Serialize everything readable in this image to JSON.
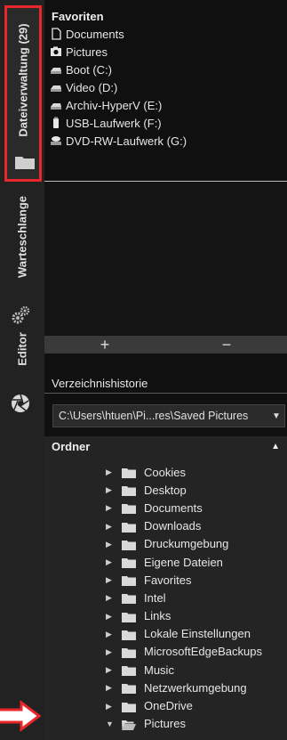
{
  "tabs": {
    "file_manager": "Dateiverwaltung (29)",
    "queue": "Warteschlange",
    "editor": "Editor"
  },
  "favorites": {
    "title": "Favoriten",
    "items": [
      {
        "label": "Documents",
        "icon": "document-icon"
      },
      {
        "label": "Pictures",
        "icon": "camera-icon"
      },
      {
        "label": "Boot (C:)",
        "icon": "drive-icon"
      },
      {
        "label": "Video (D:)",
        "icon": "drive-icon"
      },
      {
        "label": "Archiv-HyperV (E:)",
        "icon": "drive-icon"
      },
      {
        "label": "USB-Laufwerk (F:)",
        "icon": "usb-drive-icon"
      },
      {
        "label": "DVD-RW-Laufwerk (G:)",
        "icon": "dvd-drive-icon"
      }
    ],
    "add_label": "+",
    "remove_label": "−"
  },
  "history": {
    "title": "Verzeichnishistorie",
    "selected": "C:\\Users\\htuen\\Pi...res\\Saved Pictures"
  },
  "tree": {
    "title": "Ordner",
    "items": [
      {
        "label": "Cookies",
        "expanded": false
      },
      {
        "label": "Desktop",
        "expanded": false
      },
      {
        "label": "Documents",
        "expanded": false
      },
      {
        "label": "Downloads",
        "expanded": false
      },
      {
        "label": "Druckumgebung",
        "expanded": false
      },
      {
        "label": "Eigene Dateien",
        "expanded": false
      },
      {
        "label": "Favorites",
        "expanded": false
      },
      {
        "label": "Intel",
        "expanded": false
      },
      {
        "label": "Links",
        "expanded": false
      },
      {
        "label": "Lokale Einstellungen",
        "expanded": false
      },
      {
        "label": "MicrosoftEdgeBackups",
        "expanded": false
      },
      {
        "label": "Music",
        "expanded": false
      },
      {
        "label": "Netzwerkumgebung",
        "expanded": false
      },
      {
        "label": "OneDrive",
        "expanded": false
      },
      {
        "label": "Pictures",
        "expanded": true
      }
    ]
  },
  "colors": {
    "highlight": "#e8262c",
    "background": "#101010",
    "folder": "#d9d9d9"
  }
}
